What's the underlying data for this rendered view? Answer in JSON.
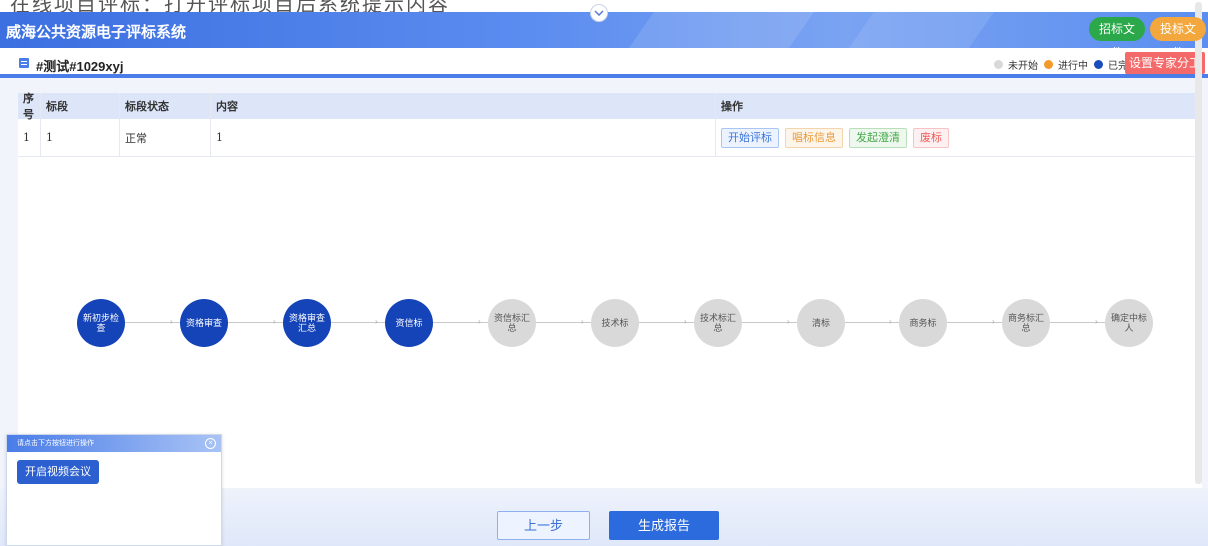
{
  "top_strip": {
    "cropped_text": "在线项目评标：打开评标项目后系统提示内容"
  },
  "header": {
    "title": "威海公共资源电子评标系统",
    "buttons": {
      "tender_doc": "招标文件",
      "bid_doc": "投标文件"
    },
    "collapse_icon": "chevron-down-icon"
  },
  "subbar": {
    "project_title": "#测试#1029xyj",
    "legend": {
      "not_started": "未开始",
      "in_progress": "进行中",
      "completed": "已完成"
    },
    "assign_button": "设置专家分工",
    "colors": {
      "not_started": "#d9d9d9",
      "in_progress": "#f39a2b",
      "completed": "#1a4dbb"
    }
  },
  "table": {
    "headers": [
      "序号",
      "标段",
      "标段状态",
      "内容",
      "操作"
    ],
    "rows": [
      {
        "index": "1",
        "section": "1",
        "status": "正常",
        "content": "1",
        "actions": [
          "开始评标",
          "唱标信息",
          "发起澄清",
          "废标"
        ]
      }
    ]
  },
  "flow": {
    "steps": [
      {
        "label": "新初步检查",
        "state": "done"
      },
      {
        "label": "资格审查",
        "state": "done"
      },
      {
        "label": "资格审查汇总",
        "state": "done"
      },
      {
        "label": "资信标",
        "state": "done"
      },
      {
        "label": "资信标汇总",
        "state": "todo"
      },
      {
        "label": "技术标",
        "state": "todo"
      },
      {
        "label": "技术标汇总",
        "state": "todo"
      },
      {
        "label": "清标",
        "state": "todo"
      },
      {
        "label": "商务标",
        "state": "todo"
      },
      {
        "label": "商务标汇总",
        "state": "todo"
      },
      {
        "label": "确定中标人",
        "state": "todo"
      }
    ]
  },
  "popup": {
    "title": "请点击下方按钮进行操作",
    "video_button": "开启视频会议"
  },
  "footer": {
    "prev_button": "上一步",
    "report_button": "生成报告"
  }
}
